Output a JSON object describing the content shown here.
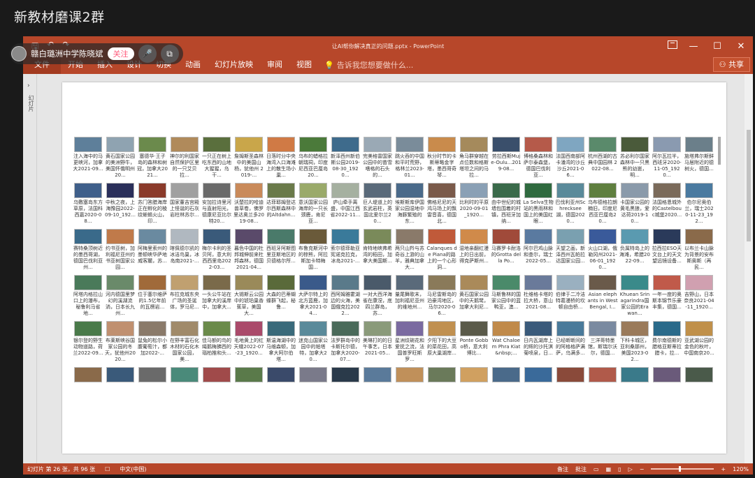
{
  "group_title": "新教材磨课2群",
  "window": {
    "doc_title": "让AI帮你解决真正的问题.pptx - PowerPoint",
    "qat": {
      "save": "🖫",
      "undo": "↶",
      "redo": "↷"
    },
    "controls": {
      "minimize": "—",
      "maximize": "☐",
      "close": "✕"
    }
  },
  "ribbon": {
    "file": "文件",
    "tabs": [
      "开始",
      "插入",
      "设计",
      "切换",
      "动画",
      "幻灯片放映",
      "审阅",
      "视图"
    ],
    "tell_me": "告诉我您想要做什么...",
    "share": "共享"
  },
  "live": {
    "name": "赣白璐洲中学陈晓斌",
    "follow": "关注",
    "mic_icon": "🎤",
    "screen_icon": "⧉"
  },
  "thumb_pane": {
    "label": "幻灯片"
  },
  "explorer": {
    "items": [
      {
        "caption": "注入海中的马更峡河，加拿大2021-09...",
        "color": "#5e7f9a"
      },
      {
        "caption": "黄石国家公园的美洲野牛，美国怀俄明州20...",
        "color": "#8fa3b1"
      },
      {
        "caption": "塞德华·王子岛的森林和树冠，加拿大2021...",
        "color": "#6b8a4c"
      },
      {
        "caption": "神尔的利国家自然保护区里的一只艾贝拉...",
        "color": "#b08a5b"
      },
      {
        "caption": "一只正在树上吃东西的山地大猩猩，乌干...",
        "color": "#5a6f3d"
      },
      {
        "caption": "詹姆斯圣森林中的美国山杨，犹他州 2019-...",
        "color": "#c9a64a"
      },
      {
        "caption": "日落时分中央海湾入口海滩上的散生场小巢...",
        "color": "#d07a45"
      },
      {
        "caption": "乌布的蜡格拉朝瑞祠，印度尼西亚巴厘岛20...",
        "color": "#4b7a3a"
      },
      {
        "caption": "新泽西州新伯斯公园2019-08-30_1920...",
        "color": "#3e6b8c"
      },
      {
        "caption": "完美格雷国家公园中的苗雪嗜格的石头的...",
        "color": "#9aa9b5"
      },
      {
        "caption": "跳火吞的中国和平时荒野，格林兰2023-01...",
        "color": "#7a8c9a"
      },
      {
        "caption": "秋分时节的卡斯蒂略金字塔，墨西哥奇琴...",
        "color": "#c98b4c"
      },
      {
        "caption": "角马群穿越在点位数和格斯塔坦之间的马拉...",
        "color": "#a58a5c"
      },
      {
        "caption": "劳拉西斯Muje-Oulu...2019-08...",
        "color": "#3a4f6b"
      },
      {
        "caption": "博格桑森林和萨尔泰森堡，德国巴伐利亚...",
        "color": "#b55a4a"
      },
      {
        "caption": "法国西南部阿卡潘湾的沙丘沙丘2021-06...",
        "color": "#7fa6c1"
      },
      {
        "caption": "杭州西湖的古典中国园林 2022-08...",
        "color": "#5a8a6b"
      },
      {
        "caption": "苏必利尔国家森林中一只黑熊的幼崽，明...",
        "color": "#4a5a3a"
      },
      {
        "caption": "阿尔瓦拉半，西班牙2020-11-05_1920...",
        "color": "#8a9ab0"
      },
      {
        "caption": "施塔弗尔斯鲜马居附近的德树火，德国...",
        "color": "#6b7f8a"
      },
      {
        "caption": "乌敷塞岛东方草原，法国科西嘉2020-08...",
        "color": "#3f5f8a"
      },
      {
        "caption": "中秋之夜，上海豫园2022-09-10_192...",
        "color": "#2a2f5a"
      },
      {
        "caption": "苏门答腊海岸正在孵化的棱纹蜥蜴火山，印...",
        "color": "#8a3a2a"
      },
      {
        "caption": "国家董吉宫殿上怪诞的石灰岩柱林苏尔...",
        "color": "#a0a0a0"
      },
      {
        "caption": "安加拉诗里河与直射阳光，德康尼亚比尔特20...",
        "color": "#6a6a6a"
      },
      {
        "caption": "沃楚拉的哈迪兽草卷，佛罗里达奥兰多2019-08...",
        "color": "#c98a5a"
      },
      {
        "caption": "达菲耶姆登达尔西斯森林中的Altdahn...",
        "color": "#6a7a4a"
      },
      {
        "caption": "意沃国家公园海岸的一只长颈鹿，肯尼亚...",
        "color": "#9aaa6a"
      },
      {
        "caption": "庐山牵手离盛，中国江西省2022-11...",
        "color": "#a5b0a0"
      },
      {
        "caption": "巨人堤道上的玄武岩柱，英国北爱尔兰20...",
        "color": "#5a6a7a"
      },
      {
        "caption": "埃斯斯库伊国家公园湿地中海豚繁殖的东...",
        "color": "#4a6a8a"
      },
      {
        "caption": "佛格尼尼的天鸿马场上的飘雷音喜，德国北...",
        "color": "#7a5a4a"
      },
      {
        "caption": "比利时的平原2020-09-01_1920...",
        "color": "#8aa0b5"
      },
      {
        "caption": "由中世纪的城墙包围着的村镇，西班牙加纳...",
        "color": "#3a6a4a"
      },
      {
        "caption": "La Selva生物站的黑雨林和国上的美国红眼...",
        "color": "#2f6a3f"
      },
      {
        "caption": "巴伐利亚州Schrecksee湖，德国2020...",
        "color": "#5a8a9a"
      },
      {
        "caption": "乌布德格拉朗楠旧，印度尼西亚巴厘岛20...",
        "color": "#5f7f3f"
      },
      {
        "caption": "卡国家公园的黄毛黑狼，爱达荷2019-10...",
        "color": "#8a9aaa"
      },
      {
        "caption": "法国格恩城外的Castelbouc城堡2020...",
        "color": "#7a6a5a"
      },
      {
        "caption": "伯尔尼奥伯兰，瑞士2020-11-23_192...",
        "color": "#4a7aa0"
      },
      {
        "caption": "赛特桑顶树近的墨西哥湖，德国巴伐利亚州...",
        "color": "#3a6a8a"
      },
      {
        "caption": "约书亚树，加利福尼亚州约书亚树国家公园...",
        "color": "#c07a4a"
      },
      {
        "caption": "阿梅里索州的墨顿峡华萨地威客麓，苏...",
        "color": "#6a8aa0"
      },
      {
        "caption": "喀佩德尔凯的冰洁鸟巢，冰岛南2021-...",
        "color": "#b0b8c0"
      },
      {
        "caption": "梅尔卡利的圣贝阿，意大利西西里岛2022-03...",
        "color": "#3a5a7a"
      },
      {
        "caption": "暮色中国的杜邦城伸前来杜邦森林，德国2021-04...",
        "color": "#5a4a6a"
      },
      {
        "caption": "西班牙阿斯图里亚斯地区的贝德格尔所...",
        "color": "#4a7a6a"
      },
      {
        "caption": "布鲁克斯河中的棕熊，阿拉斯加卡特梅国...",
        "color": "#6a5a3a"
      },
      {
        "caption": "索尔德菲勒亚宪诺克拉克，冰岛2021-...",
        "color": "#3a7a9a"
      },
      {
        "caption": "肯特地峡弗希湾的稻田，加拿大美国斯...",
        "color": "#7a8a5a"
      },
      {
        "caption": "两只山羚与苏奇谷上游的山羊，雅典加拿大...",
        "color": "#8a7a6a"
      },
      {
        "caption": "Calanques de Piana的路上的一个心形洞...",
        "color": "#c05a3a"
      },
      {
        "caption": "湿地亲翻红漫上的日出前，得克萨斯州...",
        "color": "#d08a4a"
      },
      {
        "caption": "马賽罗卡耐洛的Grotta della Po...",
        "color": "#a04a3a"
      },
      {
        "caption": "阿尔巴鸡山脉和查尔，瑞士2022-05...",
        "color": "#5a7aa0"
      },
      {
        "caption": "天望之画，新泽西州瓦帕拉达国家公园...",
        "color": "#7aa0b0"
      },
      {
        "caption": "火山口湖，俄勒冈州2021-06-01_1920...",
        "color": "#3a5a9a"
      },
      {
        "caption": "负属特岛上的海滩，希腊2022-09...",
        "color": "#5a9ab0"
      },
      {
        "caption": "拉西拉ESO天文台上的天文望远镜设备...",
        "color": "#2a3a5a"
      },
      {
        "caption": "以布兰卡山脉为背景的安布斯奥斯（再民...",
        "color": "#8a6a4a"
      },
      {
        "caption": "阿塔内格拉山口上的瀑布，秘鲁利马省地...",
        "color": "#4a7a5a"
      },
      {
        "caption": "河内德国里梦幻的溪湖流淌，日本长九州...",
        "color": "#6a8a6a"
      },
      {
        "caption": "位于塞尔维萨的1.5亿年前的瓦楞岩...",
        "color": "#a06a3a"
      },
      {
        "caption": "布拉克城东央广场的圣诞体，罗马尼...",
        "color": "#c0a070"
      },
      {
        "caption": "一头公牛站在加拿大的溪岸中，加拿大...",
        "color": "#7a6a4a"
      },
      {
        "caption": "大锡斯云公园中的琥珀巢香蕉草，美国大...",
        "color": "#9a8a5a"
      },
      {
        "caption": "大森的巴蒂蝴蝶群飞起，秘鲁...",
        "color": "#5a6a3a"
      },
      {
        "caption": "大萨尔特上的北方蓝鹿，加拿大2021-04...",
        "color": "#3a5a8a"
      },
      {
        "caption": "西阿姆雅霍湖边的火海，美国俄克拉2022...",
        "color": "#5a7a8a"
      },
      {
        "caption": "一对大西洋海雀在康涅，底四兰群岛，苏...",
        "color": "#4a5a6a"
      },
      {
        "caption": "量尾舞歌末，加利福尼亚州的维地州...",
        "color": "#5a6a7a"
      },
      {
        "caption": "马尼雷斯岛的泊豪湾地区，马尔2020-06...",
        "color": "#8a7a5a"
      },
      {
        "caption": "黄石国家公园中的天鹅鹭，加拿大利尼...",
        "color": "#aa8a5a"
      },
      {
        "caption": "马斯鲁林的国家公园中的蓝鸭亚，澳...",
        "color": "#4a8a6a"
      },
      {
        "caption": "杜维格卡塔的拉大桥，意山2021-08...",
        "color": "#6a7a9a"
      },
      {
        "caption": "伯律于二冷洁特葛漫桥的坎顿自由桥...",
        "color": "#9ab0c0"
      },
      {
        "caption": "Asian elephants in West Bengal, I...",
        "color": "#6a5a4a"
      },
      {
        "caption": "Khuean Srinagarindra国家公园的Erawan...",
        "color": "#3a8a8a"
      },
      {
        "caption": "一年一度的奥斯本锦节乐豪丰集，德国...",
        "color": "#c05a4a"
      },
      {
        "caption": "吉野山，日本奈良2021-04-11_1920...",
        "color": "#d0a0b0"
      },
      {
        "caption": "银尔登的野生动物道路，荷兰2022-09...",
        "color": "#4a7a4a"
      },
      {
        "caption": "布莱斯峡谷国家公园的冬天，犹他州2020...",
        "color": "#c09070"
      },
      {
        "caption": "鼠兔的松尔小腹葡萄汁，都加2022-...",
        "color": "#8a7a6a"
      },
      {
        "caption": "在野丰富石化木材的石化木国家公园，美...",
        "color": "#a08a6a"
      },
      {
        "caption": "佳马额的鸟的绳鹅梅拂西的瑙柏推和头...",
        "color": "#6a8a4a"
      },
      {
        "caption": "毛地黄上的红天蛾2022-07-23_1920...",
        "color": "#aa4a6a"
      },
      {
        "caption": "斯温海湖中的马维森顿，加拿大阿尔伯塔...",
        "color": "#3a6a7a"
      },
      {
        "caption": "迷克山国家公园中的帕塔特，加拿大20...",
        "color": "#5a8a9a"
      },
      {
        "caption": "法罗群岛中的卡斯托尔德，加拿大2020-07...",
        "color": "#4a6a5a"
      },
      {
        "caption": "美琳打的的日午事艺，日本2021-05...",
        "color": "#8a9a7a"
      },
      {
        "caption": "星洲纹碗花和爱抚之流，法国普罗旺斯罗...",
        "color": "#7a6aa0"
      },
      {
        "caption": "夕阳下的大豆的菜花田，高原大巢湖岸...",
        "color": "#c09050"
      },
      {
        "caption": "Ponte Gobbo桥，意大利博比...",
        "color": "#5a5a4a"
      },
      {
        "caption": "Wat Chaloem Phra Kiat&nbsp;...",
        "color": "#c08a4a"
      },
      {
        "caption": "日内瓦湖岸上的辉的沙托淇菊喷泉，日...",
        "color": "#3a5a7a"
      },
      {
        "caption": "已经断断间的的阿格格萨满萨，乌满多...",
        "color": "#4a7a9a"
      },
      {
        "caption": "三洋哥特墨馆，斯瑞尔沃尔，德国...",
        "color": "#7a8aa0"
      },
      {
        "caption": "下科卡城区，亚利桑那州，美国2023-02...",
        "color": "#9a7a5a"
      },
      {
        "caption": "费尔南德斯的腊格亚斯蒂拉腊卡，拉...",
        "color": "#2a6a8a"
      },
      {
        "caption": "亚武湖公园的金色的秋叶，中国南京20...",
        "color": "#c0904a"
      },
      {
        "caption": "",
        "color": "#8a6a4a"
      },
      {
        "caption": "",
        "color": "#3a5a7a"
      },
      {
        "caption": "",
        "color": "#6a6a6a"
      },
      {
        "caption": "",
        "color": "#4a8a7a"
      },
      {
        "caption": "",
        "color": "#a04a4a"
      },
      {
        "caption": "",
        "color": "#5a7a4a"
      },
      {
        "caption": "",
        "color": "#3a4a6a"
      },
      {
        "caption": "",
        "color": "#7a7a8a"
      },
      {
        "caption": "",
        "color": "#2a3a4a"
      },
      {
        "caption": "",
        "color": "#5a7a9a"
      },
      {
        "caption": "",
        "color": "#c0905a"
      },
      {
        "caption": "",
        "color": "#6a7a5a"
      },
      {
        "caption": "",
        "color": "#d0a060"
      },
      {
        "caption": "",
        "color": "#4a6a8a"
      },
      {
        "caption": "",
        "color": "#3a6a9a"
      },
      {
        "caption": "",
        "color": "#8a4a3a"
      },
      {
        "caption": "",
        "color": "#b05a4a"
      },
      {
        "caption": "",
        "color": "#3a7a8a"
      },
      {
        "caption": "",
        "color": "#6a5a7a"
      },
      {
        "caption": "",
        "color": "#4a5a4a"
      }
    ]
  },
  "status": {
    "slide_info": "幻灯片 第 26 张，共 96 张",
    "language": "中文(中国)",
    "notes": "备注",
    "comments": "批注",
    "zoom": "120%"
  }
}
